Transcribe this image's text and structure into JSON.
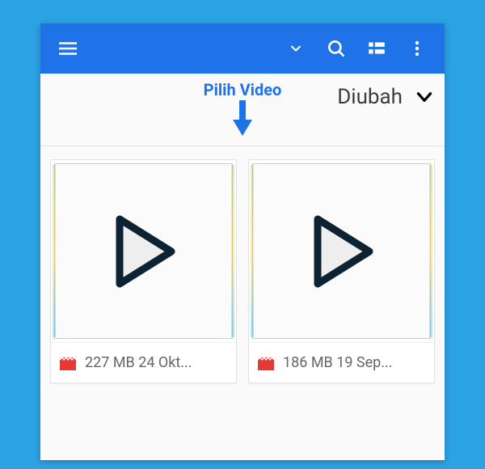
{
  "instruction_label": "Pilih Video",
  "sort": {
    "label": "Diubah"
  },
  "videos": [
    {
      "meta": "227 MB 24 Okt..."
    },
    {
      "meta": "186 MB 19 Sep..."
    }
  ]
}
